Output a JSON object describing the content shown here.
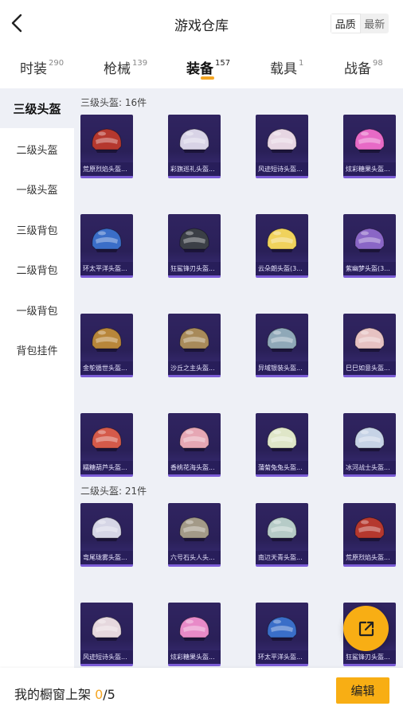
{
  "header": {
    "title": "游戏仓库",
    "sort_options": [
      "品质",
      "最新"
    ]
  },
  "tabs": [
    {
      "label": "时装",
      "count": "290"
    },
    {
      "label": "枪械",
      "count": "139"
    },
    {
      "label": "装备",
      "count": "157"
    },
    {
      "label": "载具",
      "count": "1"
    },
    {
      "label": "战备",
      "count": "98"
    }
  ],
  "sidebar": {
    "items": [
      "三级头盔",
      "二级头盔",
      "一级头盔",
      "三级背包",
      "二级背包",
      "一级背包",
      "背包挂件"
    ]
  },
  "sections": [
    {
      "title": "三级头盔: 16件",
      "items": [
        {
          "name": "荒原烈焰头盔...",
          "color": "#b5382e"
        },
        {
          "name": "彩旗巡礼头盔...",
          "color": "#d8d3e6"
        },
        {
          "name": "风迹短诗头盔...",
          "color": "#e7d6e3"
        },
        {
          "name": "炫彩糖果头盔...",
          "color": "#e76ac6"
        },
        {
          "name": "环太平洋头盔...",
          "color": "#3a6ec8"
        },
        {
          "name": "狂鲨锋刃头盔...",
          "color": "#3b3f46"
        },
        {
          "name": "云朵朗头盔(3...",
          "color": "#f0d25c"
        },
        {
          "name": "紫幽梦头盔(3...",
          "color": "#8a66c6"
        },
        {
          "name": "金鸵循世头盔...",
          "color": "#b8863a"
        },
        {
          "name": "沙丘之主头盔...",
          "color": "#a88a5a"
        },
        {
          "name": "异域银装头盔...",
          "color": "#8fa8b8"
        },
        {
          "name": "巳巳如意头盔...",
          "color": "#e6c2c2"
        },
        {
          "name": "糯糖葫芦头盔...",
          "color": "#d55a4a"
        },
        {
          "name": "香桃花海头盔...",
          "color": "#e6a7b4"
        },
        {
          "name": "蒲菊兔兔头盔...",
          "color": "#dfe6c8"
        },
        {
          "name": "冰河战士头盔...",
          "color": "#c6d3e6"
        }
      ]
    },
    {
      "title": "二级头盔: 21件",
      "items": [
        {
          "name": "弯尾珑雾头盔...",
          "color": "#d6d6e6"
        },
        {
          "name": "六号石头人头...",
          "color": "#a39a88"
        },
        {
          "name": "南辺天青头盔...",
          "color": "#b6cbc7"
        },
        {
          "name": "荒原烈焰头盔...",
          "color": "#b5382e"
        },
        {
          "name": "风迹短诗头盔...",
          "color": "#e6d8de"
        },
        {
          "name": "炫彩糖果头盔...",
          "color": "#e88ac8"
        },
        {
          "name": "环太平洋头盔...",
          "color": "#3a6ec8"
        },
        {
          "name": "狂鲨锋刃头盔...",
          "color": "#4a4f5a"
        }
      ]
    }
  ],
  "footer": {
    "text": "我的橱窗上架 ",
    "current": "0",
    "total": "/5",
    "edit_label": "编辑"
  },
  "colors": {
    "accent": "#f8ae14",
    "card_bg": "#2a2058",
    "content_bg": "#eef0f6"
  }
}
